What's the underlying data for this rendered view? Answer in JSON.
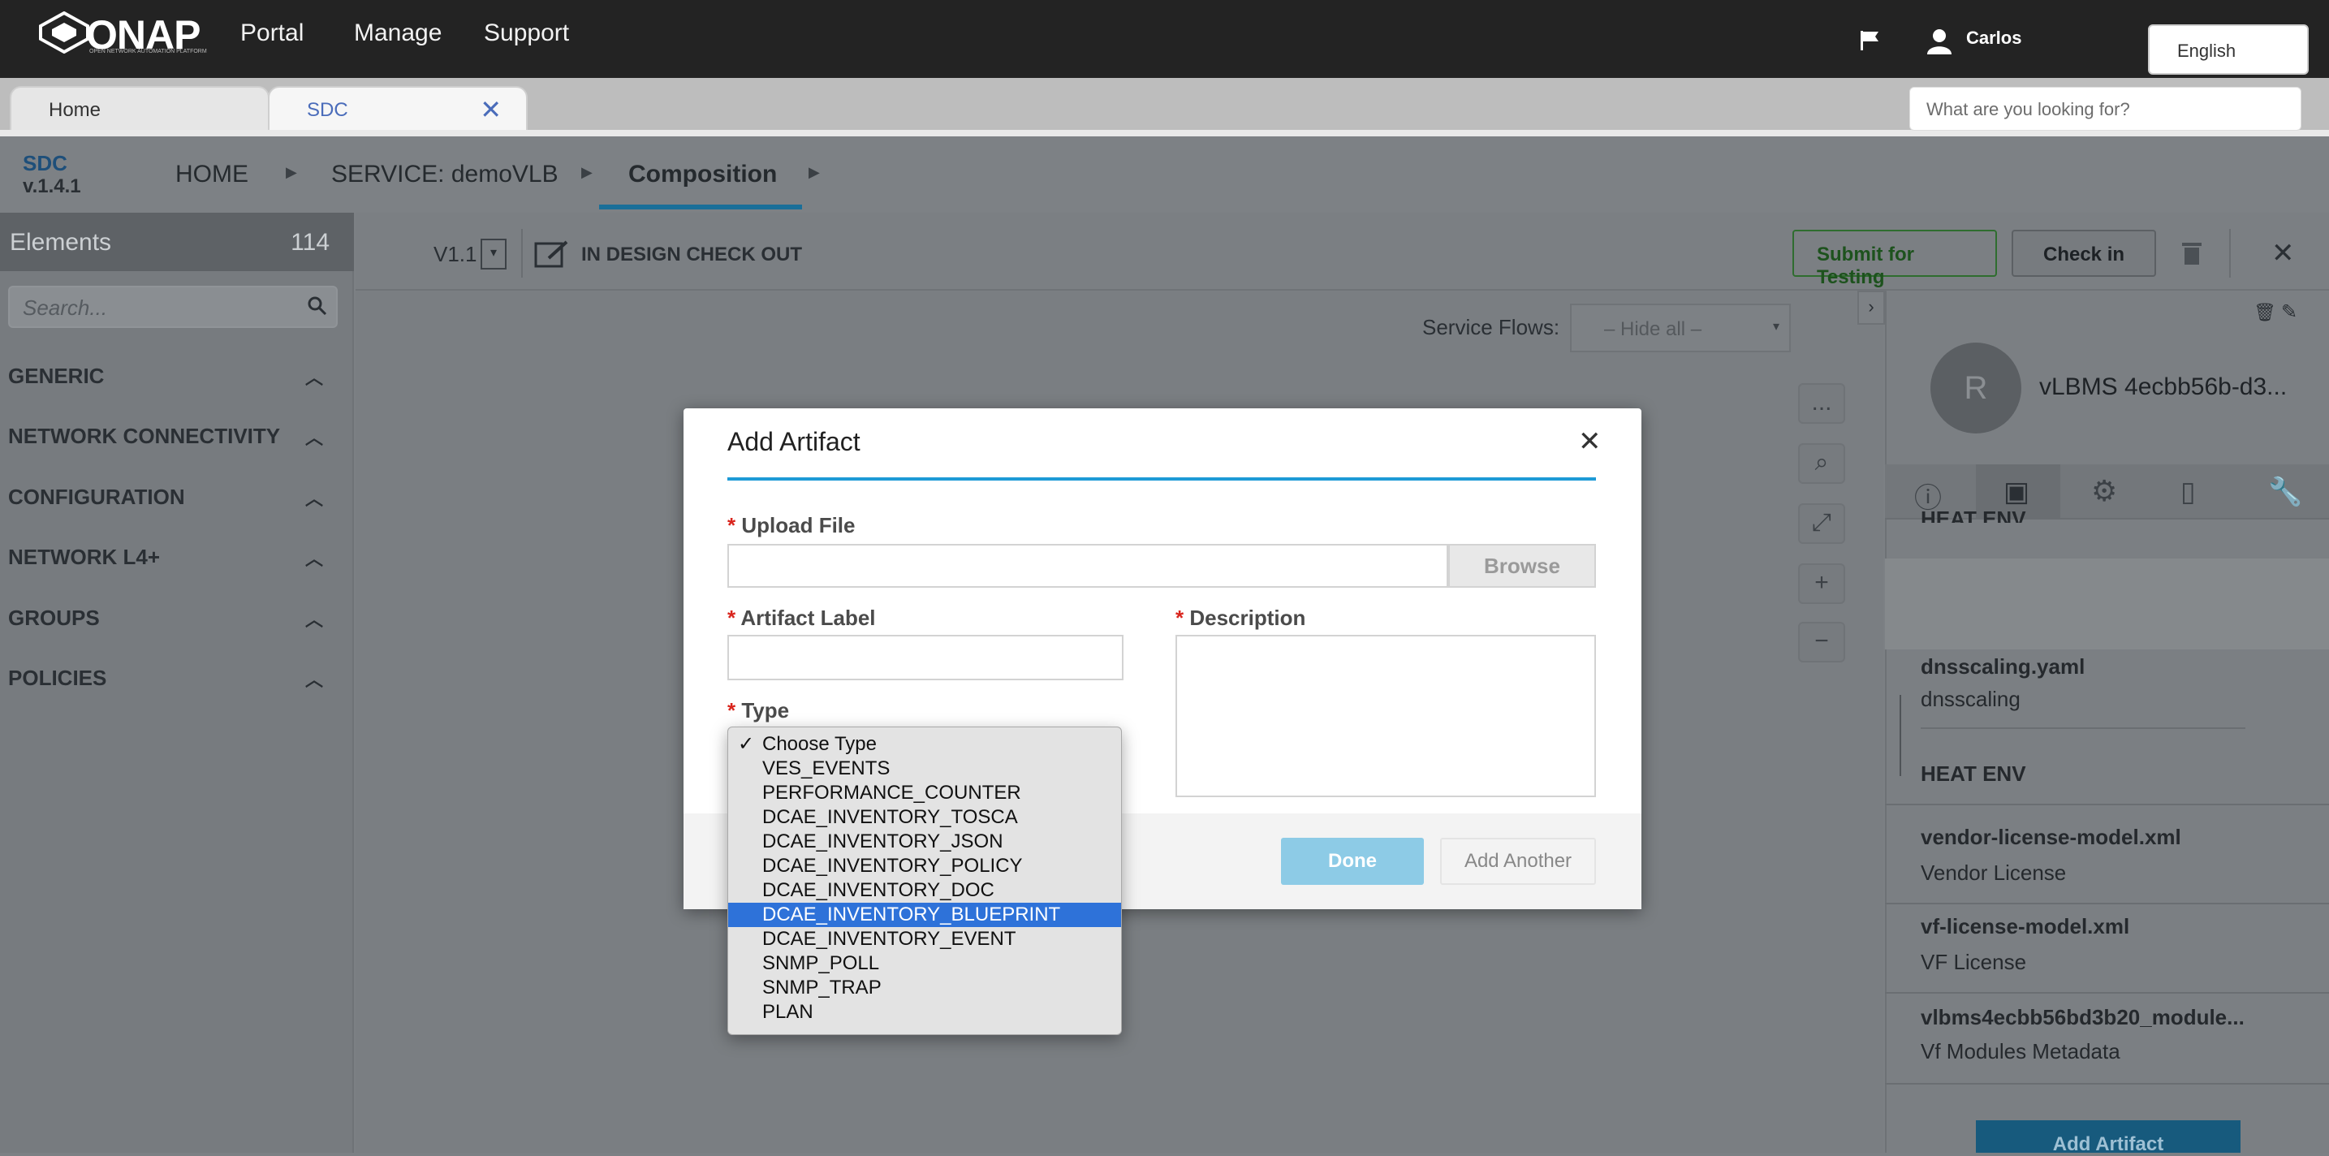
{
  "app": {
    "logo_text": "ONAP",
    "logo_subtext": "OPEN NETWORK AUTOMATION PLATFORM",
    "nav": [
      "Portal",
      "Manage",
      "Support"
    ],
    "user": "Carlos",
    "language": "English",
    "tabs": [
      "Home",
      "SDC"
    ],
    "search_placeholder": "What are you looking for?"
  },
  "sdc": {
    "name": "SDC",
    "version": "v.1.4.1",
    "breadcrumb": [
      "HOME",
      "SERVICE: demoVLB",
      "Composition"
    ]
  },
  "left_panel": {
    "title": "Elements",
    "count": "114",
    "search_placeholder": "Search...",
    "categories": [
      "GENERIC",
      "NETWORK CONNECTIVITY",
      "CONFIGURATION",
      "NETWORK L4+",
      "GROUPS",
      "POLICIES"
    ]
  },
  "toolbar": {
    "version": "V1.1",
    "status": "IN DESIGN CHECK OUT",
    "submit_label": "Submit for Testing",
    "checkin_label": "Check in"
  },
  "canvas": {
    "service_flows_label": "Service Flows:",
    "service_flows_value": "– Hide all –",
    "more_label": "..."
  },
  "right_panel": {
    "avatar_letter": "R",
    "component_name": "vLBMS 4ecbb56b-d3...",
    "partial_top": "HEAT ENV",
    "artifacts": [
      {
        "file": "dnsscaling.yaml",
        "label": "dnsscaling",
        "env": "HEAT ENV"
      },
      {
        "file": "vendor-license-model.xml",
        "label": "Vendor License"
      },
      {
        "file": "vf-license-model.xml",
        "label": "VF License"
      },
      {
        "file": "vlbms4ecbb56bd3b20_module...",
        "label": "Vf Modules Metadata"
      }
    ],
    "add_artifact_label": "Add Artifact"
  },
  "modal": {
    "title": "Add Artifact",
    "upload_label": "Upload File",
    "browse_label": "Browse",
    "artifact_label_label": "Artifact Label",
    "description_label": "Description",
    "type_label": "Type",
    "done_label": "Done",
    "add_another_label": "Add Another",
    "required_mark": "*"
  },
  "type_dropdown": {
    "checkmark": "✓",
    "options": [
      "Choose Type",
      "VES_EVENTS",
      "PERFORMANCE_COUNTER",
      "DCAE_INVENTORY_TOSCA",
      "DCAE_INVENTORY_JSON",
      "DCAE_INVENTORY_POLICY",
      "DCAE_INVENTORY_DOC",
      "DCAE_INVENTORY_BLUEPRINT",
      "DCAE_INVENTORY_EVENT",
      "SNMP_POLL",
      "SNMP_TRAP",
      "PLAN"
    ],
    "checked_index": 0,
    "highlighted_index": 7
  },
  "colors": {
    "topbar": "#232323",
    "accent_blue": "#1e9ad6",
    "done_button": "#8dcbe6",
    "submit_green": "#2f8f2f",
    "highlight": "#2e72d9"
  }
}
